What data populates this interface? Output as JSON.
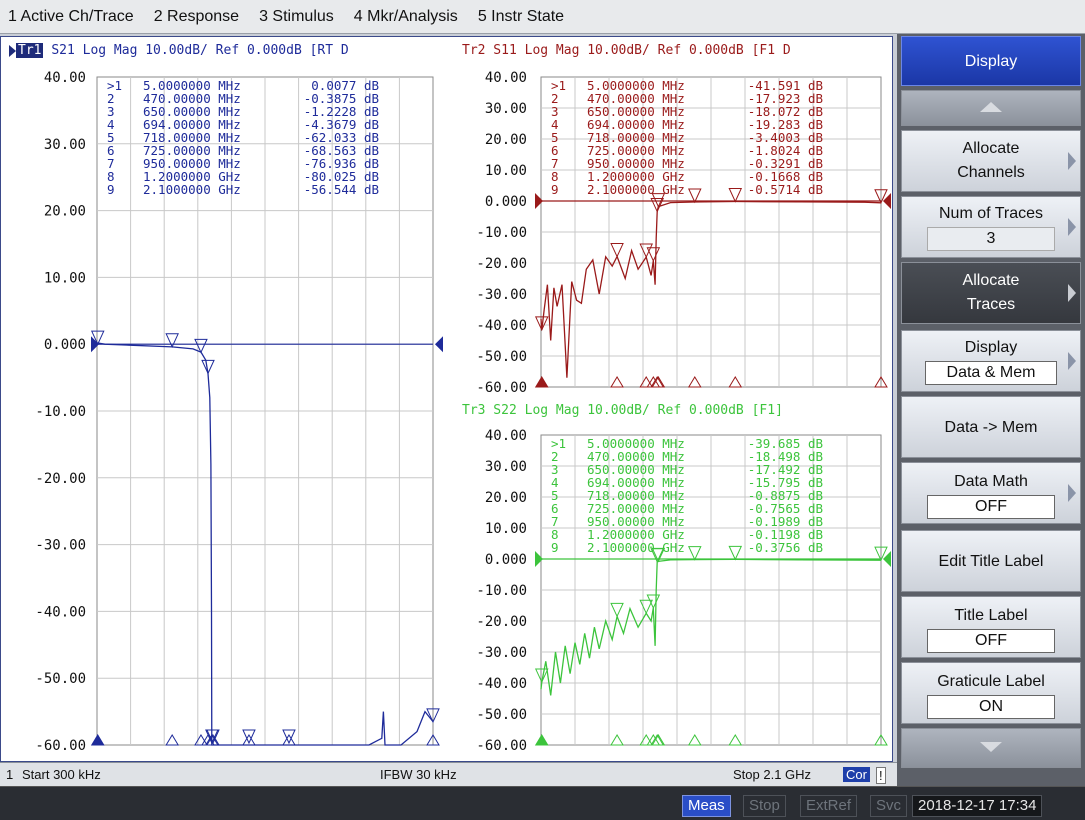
{
  "menu": [
    {
      "label": "1 Active Ch/Trace"
    },
    {
      "label": "2 Response"
    },
    {
      "label": "3 Stimulus"
    },
    {
      "label": "4 Mkr/Analysis"
    },
    {
      "label": "5 Instr State"
    }
  ],
  "marker_freqs": [
    "5.0000000 MHz",
    "470.00000 MHz",
    "650.00000 MHz",
    "694.00000 MHz",
    "718.00000 MHz",
    "725.00000 MHz",
    "950.00000 MHz",
    "1.2000000 GHz",
    "2.1000000 GHz"
  ],
  "traces": [
    {
      "id": "tr1",
      "tag": "Tr1",
      "header": "S21 Log Mag 10.00dB/ Ref 0.000dB [RT D",
      "color": "#1e2b9a",
      "ref_label": "0.000",
      "ytick_labels": [
        "40.00",
        "30.00",
        "20.00",
        "10.00",
        "0.000",
        "-10.00",
        "-20.00",
        "-30.00",
        "-40.00",
        "-50.00",
        "-60.00"
      ],
      "marker_values": [
        "0.0077 dB",
        "-0.3875 dB",
        "-1.2228 dB",
        "-4.3679 dB",
        "-62.033 dB",
        "-68.563 dB",
        "-76.936 dB",
        "-80.025 dB",
        "-56.544 dB"
      ]
    },
    {
      "id": "tr2",
      "header": "Tr2 S11 Log Mag 10.00dB/ Ref 0.000dB [F1 D",
      "color": "#9a1a1a",
      "ref_label": "0.000",
      "ytick_labels": [
        "40.00",
        "30.00",
        "20.00",
        "10.00",
        "0.000",
        "-10.00",
        "-20.00",
        "-30.00",
        "-40.00",
        "-50.00",
        "-60.00"
      ],
      "marker_values": [
        "-41.591 dB",
        "-17.923 dB",
        "-18.072 dB",
        "-19.283 dB",
        "-3.4003 dB",
        "-1.8024 dB",
        "-0.3291 dB",
        "-0.1668 dB",
        "-0.5714 dB"
      ]
    },
    {
      "id": "tr3",
      "header": "Tr3 S22 Log Mag 10.00dB/ Ref 0.000dB [F1]",
      "color": "#3cc43c",
      "ref_label": "0.000",
      "ytick_labels": [
        "40.00",
        "30.00",
        "20.00",
        "10.00",
        "0.000",
        "-10.00",
        "-20.00",
        "-30.00",
        "-40.00",
        "-50.00",
        "-60.00"
      ],
      "marker_values": [
        "-39.685 dB",
        "-18.498 dB",
        "-17.492 dB",
        "-15.795 dB",
        "-0.8875 dB",
        "-0.7565 dB",
        "-0.1989 dB",
        "-0.1198 dB",
        "-0.3756 dB"
      ]
    }
  ],
  "status": {
    "channel": "1",
    "start": "Start 300 kHz",
    "ifbw": "IFBW 30 kHz",
    "stop": "Stop 2.1 GHz",
    "cor": "Cor",
    "alert": "!"
  },
  "bottom": {
    "meas": "Meas",
    "stop": "Stop",
    "extref": "ExtRef",
    "svc": "Svc",
    "datetime": "2018-12-17 17:34"
  },
  "softkeys": {
    "title": "Display",
    "allocate_channels": [
      "Allocate",
      "Channels"
    ],
    "num_traces": {
      "label": "Num of Traces",
      "value": "3"
    },
    "allocate_traces": [
      "Allocate",
      "Traces"
    ],
    "display": {
      "label": "Display",
      "value": "Data & Mem"
    },
    "data_mem": "Data -> Mem",
    "data_math": {
      "label": "Data Math",
      "value": "OFF"
    },
    "edit_title": "Edit Title Label",
    "title_label": {
      "label": "Title Label",
      "value": "OFF"
    },
    "graticule_label": {
      "label": "Graticule Label",
      "value": "ON"
    }
  },
  "chart_data": [
    {
      "type": "line",
      "title": "S21 Log Mag 10.00dB/ Ref 0.000dB",
      "ylim": [
        -60,
        40
      ],
      "x_unit": "Hz",
      "xlim": [
        300000,
        2100000000
      ],
      "marker_x_hz": [
        5000000,
        470000000,
        650000000,
        694000000,
        718000000,
        725000000,
        950000000,
        1200000000,
        2100000000
      ],
      "marker_y_db": [
        0.0077,
        -0.3875,
        -1.2228,
        -4.3679,
        -62.033,
        -68.563,
        -76.936,
        -80.025,
        -56.544
      ],
      "series": [
        {
          "x": [
            300000,
            50000000,
            470000000,
            600000000,
            650000000,
            680000000,
            694000000,
            705000000,
            712000000,
            716000000,
            718000000,
            725000000,
            900000000,
            1200000000,
            1500000000,
            1700000000,
            1780000000,
            1790000000,
            1800000000,
            1900000000,
            2000000000,
            2050000000,
            2100000000
          ],
          "y": [
            0.2,
            0.0,
            -0.4,
            -0.7,
            -1.2,
            -2.4,
            -4.4,
            -8,
            -18,
            -40,
            -60,
            -60,
            -60,
            -60,
            -60,
            -60,
            -59,
            -55,
            -60,
            -60,
            -58,
            -55,
            -56.5
          ]
        }
      ]
    },
    {
      "type": "line",
      "title": "S11 Log Mag 10.00dB/ Ref 0.000dB",
      "ylim": [
        -60,
        40
      ],
      "x_unit": "Hz",
      "xlim": [
        300000,
        2100000000
      ],
      "marker_x_hz": [
        5000000,
        470000000,
        650000000,
        694000000,
        718000000,
        725000000,
        950000000,
        1200000000,
        2100000000
      ],
      "marker_y_db": [
        -41.591,
        -17.923,
        -18.072,
        -19.283,
        -3.4003,
        -1.8024,
        -0.3291,
        -0.1668,
        -0.5714
      ],
      "series": [
        {
          "x": [
            300000,
            5000000,
            20000000,
            40000000,
            60000000,
            80000000,
            100000000,
            130000000,
            160000000,
            190000000,
            220000000,
            250000000,
            280000000,
            320000000,
            360000000,
            400000000,
            440000000,
            470000000,
            520000000,
            560000000,
            600000000,
            650000000,
            680000000,
            694000000,
            705000000,
            712000000,
            718000000,
            725000000,
            800000000,
            950000000,
            1200000000,
            1600000000,
            2000000000,
            2100000000
          ],
          "y": [
            -38,
            -41.6,
            -35,
            -27,
            -45,
            -28,
            -34,
            -27,
            -57,
            -26,
            -32,
            -33,
            -22,
            -19,
            -30,
            -18,
            -21,
            -17.9,
            -25,
            -16,
            -22,
            -18.1,
            -24,
            -19.3,
            -27,
            -12,
            -3.4,
            -1.8,
            -0.5,
            -0.33,
            -0.17,
            -0.3,
            -0.4,
            -0.57
          ]
        }
      ]
    },
    {
      "type": "line",
      "title": "S22 Log Mag 10.00dB/ Ref 0.000dB",
      "ylim": [
        -60,
        40
      ],
      "x_unit": "Hz",
      "xlim": [
        300000,
        2100000000
      ],
      "marker_x_hz": [
        5000000,
        470000000,
        650000000,
        694000000,
        718000000,
        725000000,
        950000000,
        1200000000,
        2100000000
      ],
      "marker_y_db": [
        -39.685,
        -18.498,
        -17.492,
        -15.795,
        -0.8875,
        -0.7565,
        -0.1989,
        -0.1198,
        -0.3756
      ],
      "series": [
        {
          "x": [
            300000,
            5000000,
            30000000,
            60000000,
            90000000,
            120000000,
            150000000,
            180000000,
            210000000,
            240000000,
            270000000,
            300000000,
            330000000,
            360000000,
            400000000,
            440000000,
            470000000,
            510000000,
            550000000,
            600000000,
            650000000,
            680000000,
            694000000,
            705000000,
            712000000,
            718000000,
            725000000,
            800000000,
            950000000,
            1200000000,
            1600000000,
            2100000000
          ],
          "y": [
            -42,
            -39.7,
            -33,
            -44,
            -30,
            -40,
            -28,
            -37,
            -27,
            -34,
            -24,
            -32,
            -22,
            -29,
            -20,
            -26,
            -18.5,
            -24,
            -16,
            -22,
            -17.5,
            -20,
            -15.8,
            -28,
            -10,
            -0.9,
            -0.76,
            -0.3,
            -0.2,
            -0.12,
            -0.3,
            -0.38
          ]
        }
      ]
    }
  ]
}
